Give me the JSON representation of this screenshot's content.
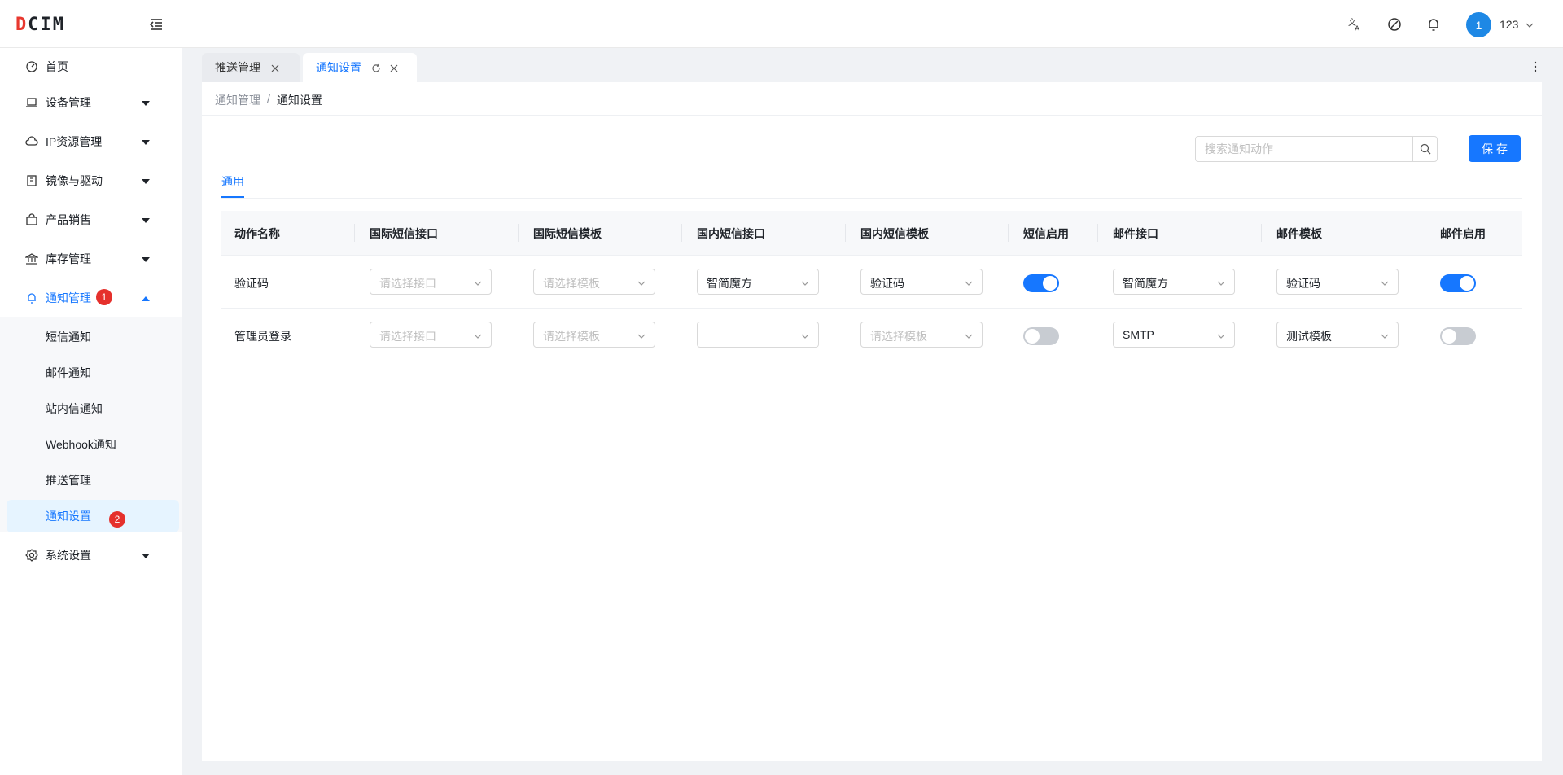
{
  "app": {
    "logo": "DCIM",
    "logo_first": "D",
    "logo_rest": "CIM"
  },
  "header": {
    "avatar_text": "1",
    "username": "123"
  },
  "sidebar": {
    "items": [
      {
        "label": "首页",
        "icon": "dashboard-icon"
      },
      {
        "label": "设备管理",
        "icon": "laptop-icon"
      },
      {
        "label": "IP资源管理",
        "icon": "cloud-icon"
      },
      {
        "label": "镜像与驱动",
        "icon": "book-icon"
      },
      {
        "label": "产品销售",
        "icon": "shopping-bag-icon"
      },
      {
        "label": "库存管理",
        "icon": "bank-icon"
      },
      {
        "label": "通知管理",
        "icon": "bell-icon",
        "badge": "1"
      },
      {
        "label": "系统设置",
        "icon": "gear-icon"
      }
    ],
    "sub_items": [
      {
        "label": "短信通知"
      },
      {
        "label": "邮件通知"
      },
      {
        "label": "站内信通知"
      },
      {
        "label": "Webhook通知"
      },
      {
        "label": "推送管理"
      },
      {
        "label": "通知设置",
        "badge": "2"
      }
    ]
  },
  "tabs": [
    {
      "label": "推送管理"
    },
    {
      "label": "通知设置"
    }
  ],
  "breadcrumb": {
    "parent": "通知管理",
    "separator": "/",
    "current": "通知设置"
  },
  "search": {
    "placeholder": "搜索通知动作",
    "value": ""
  },
  "save_label": "保存",
  "inner_tab": "通用",
  "table": {
    "headers": [
      "动作名称",
      "国际短信接口",
      "国际短信模板",
      "国内短信接口",
      "国内短信模板",
      "短信启用",
      "邮件接口",
      "邮件模板",
      "邮件启用"
    ],
    "rows": [
      {
        "name": "验证码",
        "intl_sms_api": {
          "value": "",
          "placeholder": "请选择接口"
        },
        "intl_sms_tpl": {
          "value": "",
          "placeholder": "请选择模板"
        },
        "dom_sms_api": {
          "value": "智简魔方",
          "placeholder": ""
        },
        "dom_sms_tpl": {
          "value": "验证码",
          "placeholder": ""
        },
        "sms_enabled": true,
        "mail_api": {
          "value": "智简魔方",
          "placeholder": ""
        },
        "mail_tpl": {
          "value": "验证码",
          "placeholder": ""
        },
        "mail_enabled": true
      },
      {
        "name": "管理员登录",
        "intl_sms_api": {
          "value": "",
          "placeholder": "请选择接口"
        },
        "intl_sms_tpl": {
          "value": "",
          "placeholder": "请选择模板"
        },
        "dom_sms_api": {
          "value": "",
          "placeholder": ""
        },
        "dom_sms_tpl": {
          "value": "",
          "placeholder": "请选择模板"
        },
        "sms_enabled": false,
        "mail_api": {
          "value": "SMTP",
          "placeholder": ""
        },
        "mail_tpl": {
          "value": "测试模板",
          "placeholder": ""
        },
        "mail_enabled": false
      }
    ]
  },
  "colors": {
    "primary": "#1677ff",
    "badge": "#e5302c",
    "logo_accent": "#e8382f"
  }
}
